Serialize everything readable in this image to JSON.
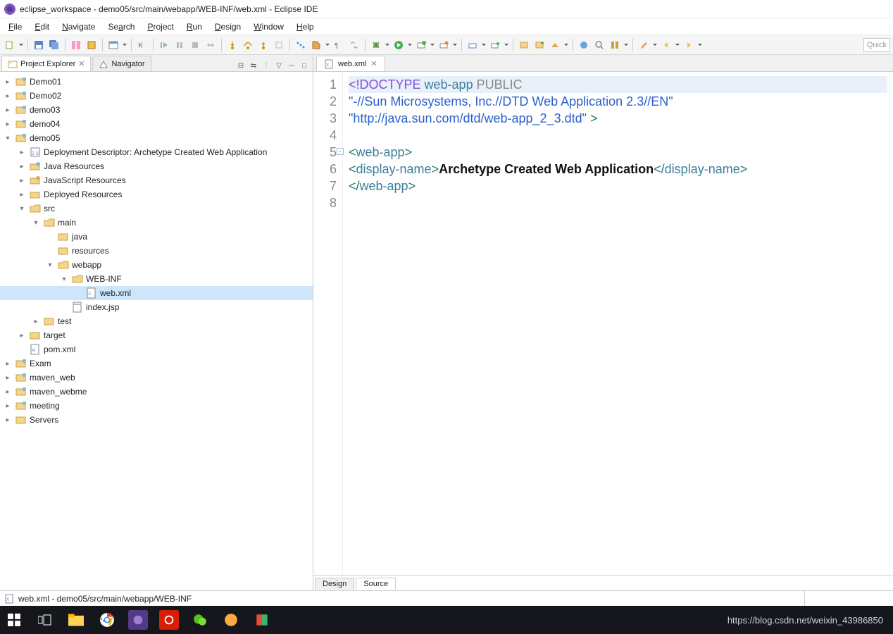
{
  "title": "eclipse_workspace - demo05/src/main/webapp/WEB-INF/web.xml - Eclipse IDE",
  "menu": [
    "File",
    "Edit",
    "Navigate",
    "Search",
    "Project",
    "Run",
    "Design",
    "Window",
    "Help"
  ],
  "quick_placeholder": "Quick",
  "explorer": {
    "tab1": "Project Explorer",
    "tab2": "Navigator"
  },
  "tree": {
    "n0": "Demo01",
    "n1": "Demo02",
    "n2": "demo03",
    "n3": "demo04",
    "n4": "demo05",
    "n5": "Deployment Descriptor: Archetype Created Web Application",
    "n6": "Java Resources",
    "n7": "JavaScript Resources",
    "n8": "Deployed Resources",
    "n9": "src",
    "n10": "main",
    "n11": "java",
    "n12": "resources",
    "n13": "webapp",
    "n14": "WEB-INF",
    "n15": "web.xml",
    "n16": "index.jsp",
    "n17": "test",
    "n18": "target",
    "n19": "pom.xml",
    "n20": "Exam",
    "n21": "maven_web",
    "n22": "maven_webme",
    "n23": "meeting",
    "n24": "Servers"
  },
  "editor_tab": "web.xml",
  "gutter": [
    "1",
    "2",
    "3",
    "4",
    "5",
    "6",
    "7",
    "8"
  ],
  "code": {
    "l1a": "<!DOCTYPE ",
    "l1b": "web-app",
    "l1c": " PUBLIC",
    "l2": " \"-//Sun Microsystems, Inc.//DTD Web Application 2.3//EN\"",
    "l3a": " \"http://java.sun.com/dtd/web-app_2_3.dtd\"",
    "l3b": " >",
    "l5a": "<",
    "l5b": "web-app",
    "l5c": ">",
    "l6a": "  <",
    "l6b": "display-name",
    "l6c": ">",
    "l6d": "Archetype Created Web Application",
    "l6e": "</",
    "l6f": "display-name",
    "l6g": ">",
    "l7a": "</",
    "l7b": "web-app",
    "l7c": ">"
  },
  "editor_footer": {
    "design": "Design",
    "source": "Source"
  },
  "status": "web.xml - demo05/src/main/webapp/WEB-INF",
  "watermark": "https://blog.csdn.net/weixin_43986850"
}
